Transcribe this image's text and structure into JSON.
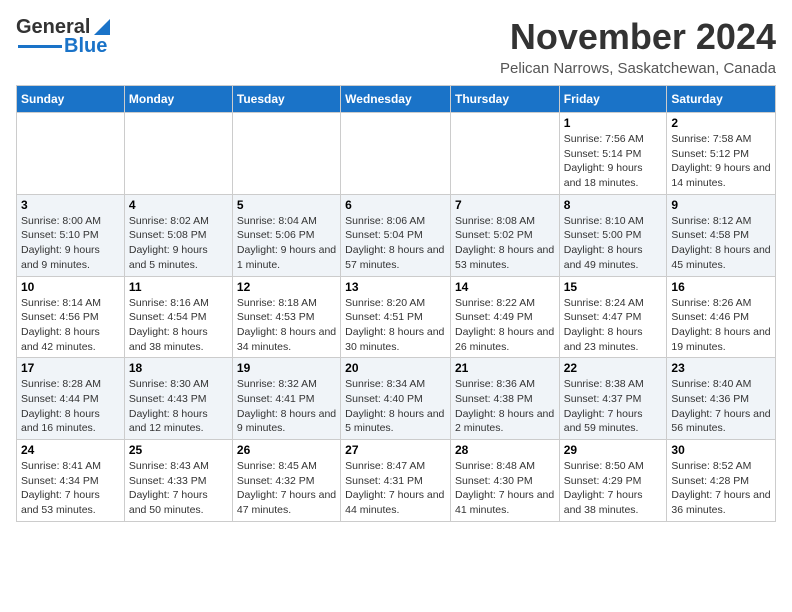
{
  "header": {
    "logo_general": "General",
    "logo_blue": "Blue",
    "month": "November 2024",
    "location": "Pelican Narrows, Saskatchewan, Canada"
  },
  "weekdays": [
    "Sunday",
    "Monday",
    "Tuesday",
    "Wednesday",
    "Thursday",
    "Friday",
    "Saturday"
  ],
  "weeks": [
    [
      {
        "day": "",
        "info": ""
      },
      {
        "day": "",
        "info": ""
      },
      {
        "day": "",
        "info": ""
      },
      {
        "day": "",
        "info": ""
      },
      {
        "day": "",
        "info": ""
      },
      {
        "day": "1",
        "info": "Sunrise: 7:56 AM\nSunset: 5:14 PM\nDaylight: 9 hours and 18 minutes."
      },
      {
        "day": "2",
        "info": "Sunrise: 7:58 AM\nSunset: 5:12 PM\nDaylight: 9 hours and 14 minutes."
      }
    ],
    [
      {
        "day": "3",
        "info": "Sunrise: 8:00 AM\nSunset: 5:10 PM\nDaylight: 9 hours and 9 minutes."
      },
      {
        "day": "4",
        "info": "Sunrise: 8:02 AM\nSunset: 5:08 PM\nDaylight: 9 hours and 5 minutes."
      },
      {
        "day": "5",
        "info": "Sunrise: 8:04 AM\nSunset: 5:06 PM\nDaylight: 9 hours and 1 minute."
      },
      {
        "day": "6",
        "info": "Sunrise: 8:06 AM\nSunset: 5:04 PM\nDaylight: 8 hours and 57 minutes."
      },
      {
        "day": "7",
        "info": "Sunrise: 8:08 AM\nSunset: 5:02 PM\nDaylight: 8 hours and 53 minutes."
      },
      {
        "day": "8",
        "info": "Sunrise: 8:10 AM\nSunset: 5:00 PM\nDaylight: 8 hours and 49 minutes."
      },
      {
        "day": "9",
        "info": "Sunrise: 8:12 AM\nSunset: 4:58 PM\nDaylight: 8 hours and 45 minutes."
      }
    ],
    [
      {
        "day": "10",
        "info": "Sunrise: 8:14 AM\nSunset: 4:56 PM\nDaylight: 8 hours and 42 minutes."
      },
      {
        "day": "11",
        "info": "Sunrise: 8:16 AM\nSunset: 4:54 PM\nDaylight: 8 hours and 38 minutes."
      },
      {
        "day": "12",
        "info": "Sunrise: 8:18 AM\nSunset: 4:53 PM\nDaylight: 8 hours and 34 minutes."
      },
      {
        "day": "13",
        "info": "Sunrise: 8:20 AM\nSunset: 4:51 PM\nDaylight: 8 hours and 30 minutes."
      },
      {
        "day": "14",
        "info": "Sunrise: 8:22 AM\nSunset: 4:49 PM\nDaylight: 8 hours and 26 minutes."
      },
      {
        "day": "15",
        "info": "Sunrise: 8:24 AM\nSunset: 4:47 PM\nDaylight: 8 hours and 23 minutes."
      },
      {
        "day": "16",
        "info": "Sunrise: 8:26 AM\nSunset: 4:46 PM\nDaylight: 8 hours and 19 minutes."
      }
    ],
    [
      {
        "day": "17",
        "info": "Sunrise: 8:28 AM\nSunset: 4:44 PM\nDaylight: 8 hours and 16 minutes."
      },
      {
        "day": "18",
        "info": "Sunrise: 8:30 AM\nSunset: 4:43 PM\nDaylight: 8 hours and 12 minutes."
      },
      {
        "day": "19",
        "info": "Sunrise: 8:32 AM\nSunset: 4:41 PM\nDaylight: 8 hours and 9 minutes."
      },
      {
        "day": "20",
        "info": "Sunrise: 8:34 AM\nSunset: 4:40 PM\nDaylight: 8 hours and 5 minutes."
      },
      {
        "day": "21",
        "info": "Sunrise: 8:36 AM\nSunset: 4:38 PM\nDaylight: 8 hours and 2 minutes."
      },
      {
        "day": "22",
        "info": "Sunrise: 8:38 AM\nSunset: 4:37 PM\nDaylight: 7 hours and 59 minutes."
      },
      {
        "day": "23",
        "info": "Sunrise: 8:40 AM\nSunset: 4:36 PM\nDaylight: 7 hours and 56 minutes."
      }
    ],
    [
      {
        "day": "24",
        "info": "Sunrise: 8:41 AM\nSunset: 4:34 PM\nDaylight: 7 hours and 53 minutes."
      },
      {
        "day": "25",
        "info": "Sunrise: 8:43 AM\nSunset: 4:33 PM\nDaylight: 7 hours and 50 minutes."
      },
      {
        "day": "26",
        "info": "Sunrise: 8:45 AM\nSunset: 4:32 PM\nDaylight: 7 hours and 47 minutes."
      },
      {
        "day": "27",
        "info": "Sunrise: 8:47 AM\nSunset: 4:31 PM\nDaylight: 7 hours and 44 minutes."
      },
      {
        "day": "28",
        "info": "Sunrise: 8:48 AM\nSunset: 4:30 PM\nDaylight: 7 hours and 41 minutes."
      },
      {
        "day": "29",
        "info": "Sunrise: 8:50 AM\nSunset: 4:29 PM\nDaylight: 7 hours and 38 minutes."
      },
      {
        "day": "30",
        "info": "Sunrise: 8:52 AM\nSunset: 4:28 PM\nDaylight: 7 hours and 36 minutes."
      }
    ]
  ]
}
